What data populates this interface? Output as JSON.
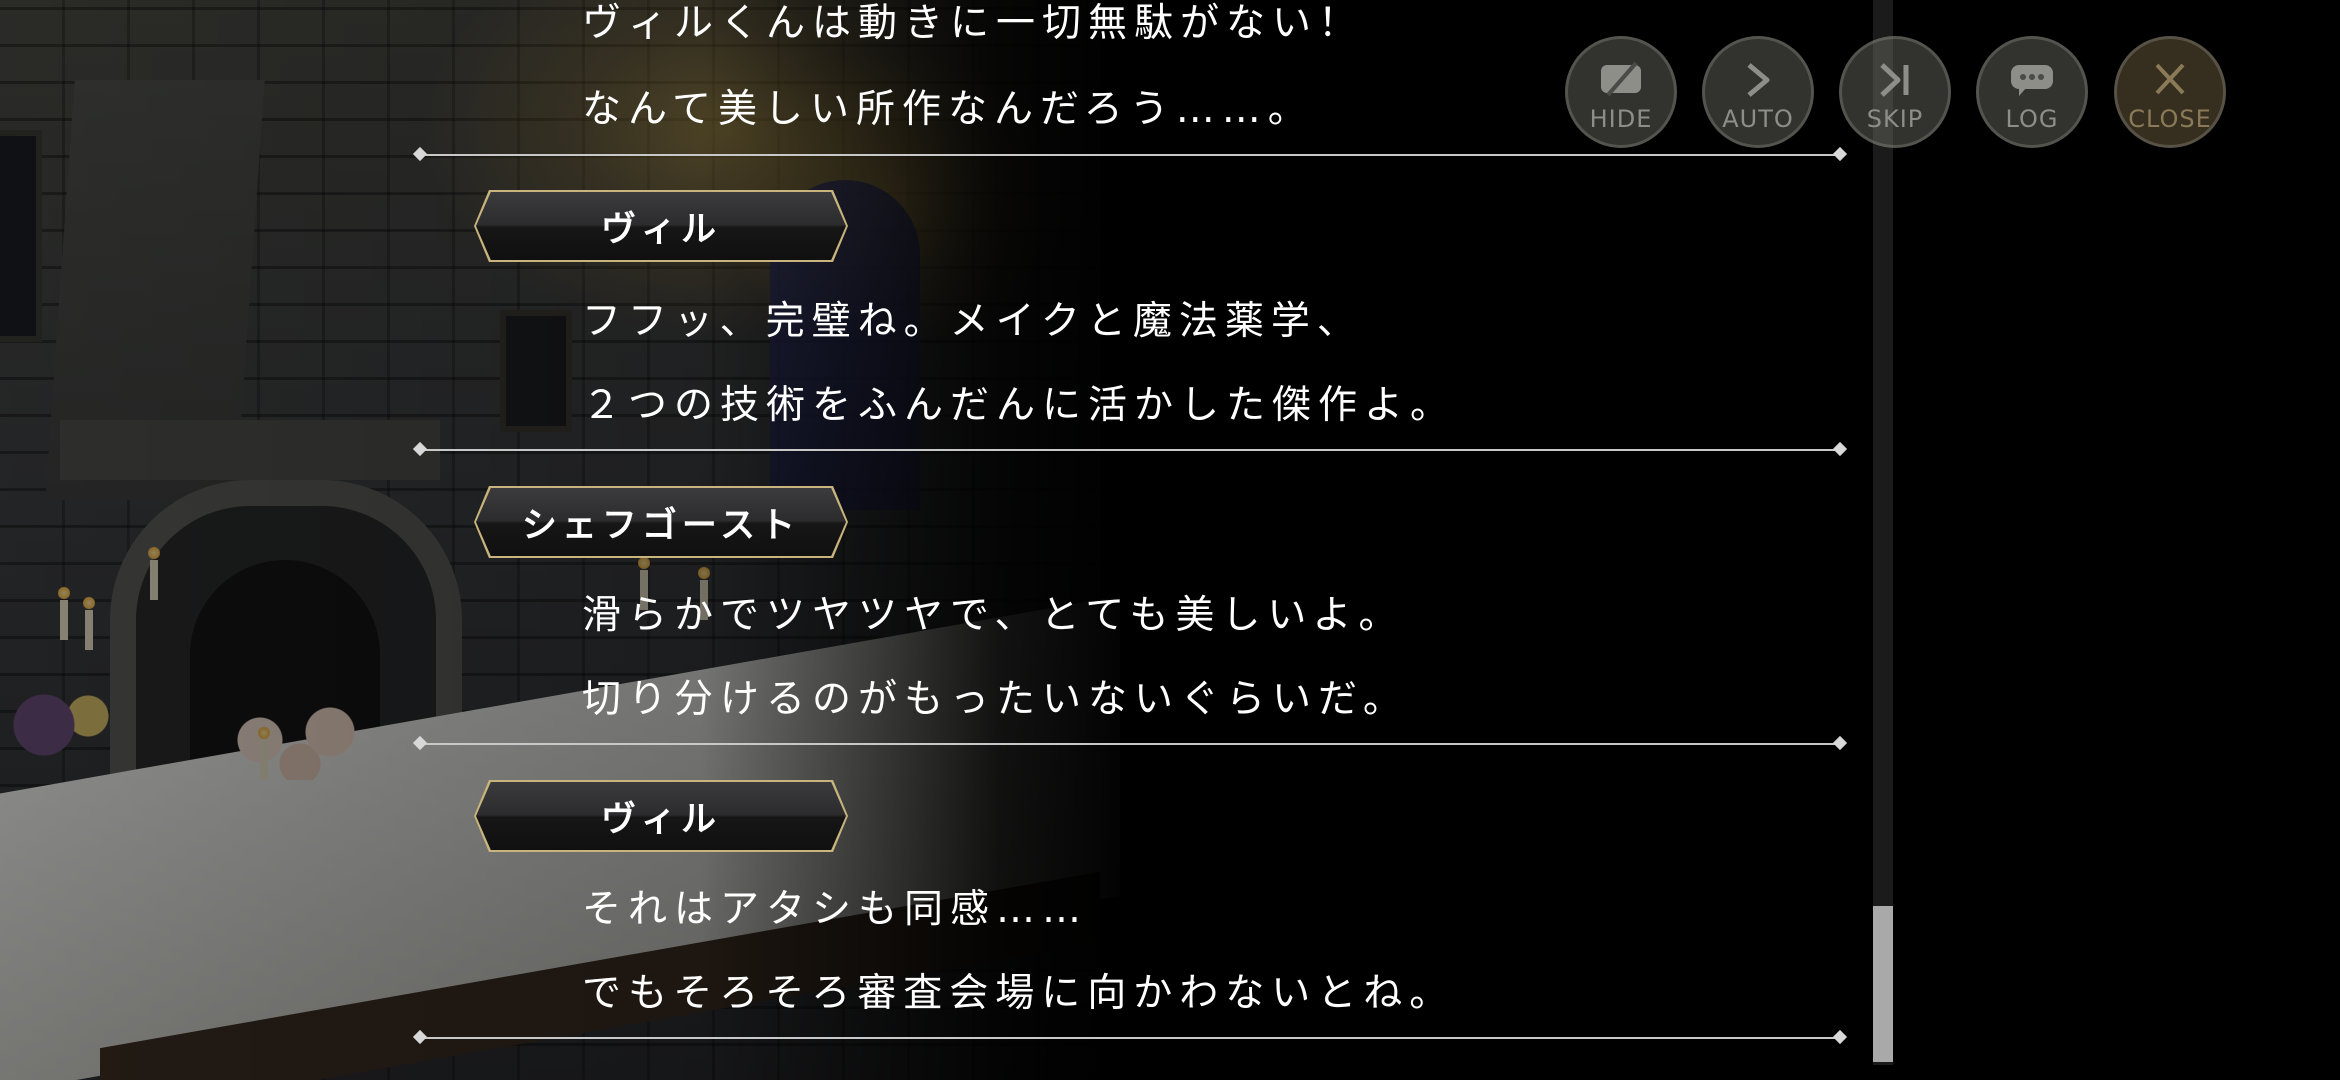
{
  "toolbar": {
    "hide_label": "HIDE",
    "auto_label": "AUTO",
    "skip_label": "SKIP",
    "log_label": "LOG",
    "close_label": "CLOSE"
  },
  "log_entries": [
    {
      "speaker": "",
      "lines": [
        "ヴィルくんは動きに一切無駄がない！",
        "なんて美しい所作なんだろう……。"
      ]
    },
    {
      "speaker": "ヴィル",
      "lines": [
        "フフッ、完璧ね。メイクと魔法薬学、",
        "２つの技術をふんだんに活かした傑作よ。"
      ]
    },
    {
      "speaker": "シェフゴースト",
      "lines": [
        "滑らかでツヤツヤで、とても美しいよ。",
        "切り分けるのがもったいないぐらいだ。"
      ]
    },
    {
      "speaker": "ヴィル",
      "lines": [
        "それはアタシも同感……",
        "でもそろそろ審査会場に向かわないとね。"
      ]
    }
  ],
  "colors": {
    "background": "#000000",
    "text": "#ffffff",
    "nameplate_border": "#c8b47c",
    "divider": "#c8c8c8",
    "scroll_thumb": "#a9a9a9"
  },
  "icons": {
    "hide": "hide-icon",
    "auto": "play-icon",
    "skip": "skip-icon",
    "log": "chat-bubble-icon",
    "close": "close-icon"
  }
}
